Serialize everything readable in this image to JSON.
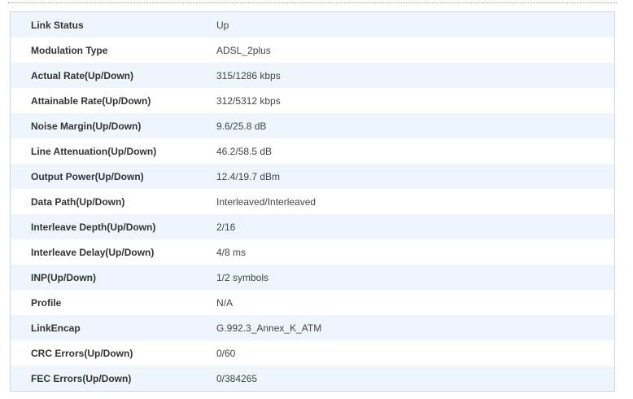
{
  "rows": [
    {
      "label": "Link Status",
      "value": "Up"
    },
    {
      "label": "Modulation Type",
      "value": "ADSL_2plus"
    },
    {
      "label": "Actual Rate(Up/Down)",
      "value": "315/1286 kbps"
    },
    {
      "label": "Attainable Rate(Up/Down)",
      "value": "312/5312 kbps"
    },
    {
      "label": "Noise Margin(Up/Down)",
      "value": "9.6/25.8 dB"
    },
    {
      "label": "Line Attenuation(Up/Down)",
      "value": "46.2/58.5 dB"
    },
    {
      "label": "Output Power(Up/Down)",
      "value": "12.4/19.7 dBm"
    },
    {
      "label": "Data Path(Up/Down)",
      "value": "Interleaved/Interleaved"
    },
    {
      "label": "Interleave Depth(Up/Down)",
      "value": "2/16"
    },
    {
      "label": "Interleave Delay(Up/Down)",
      "value": "4/8 ms"
    },
    {
      "label": "INP(Up/Down)",
      "value": "1/2 symbols"
    },
    {
      "label": "Profile",
      "value": "N/A"
    },
    {
      "label": "LinkEncap",
      "value": "G.992.3_Annex_K_ATM"
    },
    {
      "label": "CRC Errors(Up/Down)",
      "value": "0/60"
    },
    {
      "label": "FEC Errors(Up/Down)",
      "value": "0/384265"
    }
  ],
  "colors": {
    "row_alt_background": "#eef5fc",
    "row_background": "#ffffff",
    "border": "#cfd6dc",
    "text": "#333333"
  }
}
